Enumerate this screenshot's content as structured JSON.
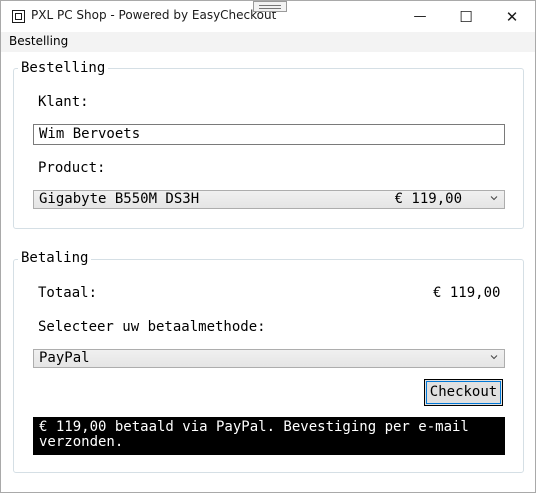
{
  "window": {
    "title": "PXL PC Shop - Powered by EasyCheckout",
    "minimize_glyph": "—",
    "maximize_glyph": "☐",
    "close_glyph": "✕"
  },
  "menu": {
    "items": [
      {
        "label": "Bestelling"
      }
    ]
  },
  "order_group": {
    "title": "Bestelling",
    "customer_label": "Klant:",
    "customer_value": "Wim Bervoets",
    "product_label": "Product:",
    "product_selected": "Gigabyte B550M DS3H",
    "product_price": "€ 119,00"
  },
  "payment_group": {
    "title": "Betaling",
    "total_label": "Totaal:",
    "total_value": "€ 119,00",
    "method_label": "Selecteer uw betaalmethode:",
    "method_selected": "PayPal",
    "checkout_label": "Checkout",
    "status_message": "€ 119,00 betaald via PayPal. Bevestiging per e-mail verzonden."
  },
  "colors": {
    "status_background": "#000000",
    "status_text": "#ffffff",
    "focus_outline": "#0078d7",
    "group_border": "#d5dfe5"
  },
  "icons": [
    "app-icon",
    "grip-icon",
    "minimize-icon",
    "maximize-icon",
    "close-icon",
    "chevron-down-icon"
  ]
}
